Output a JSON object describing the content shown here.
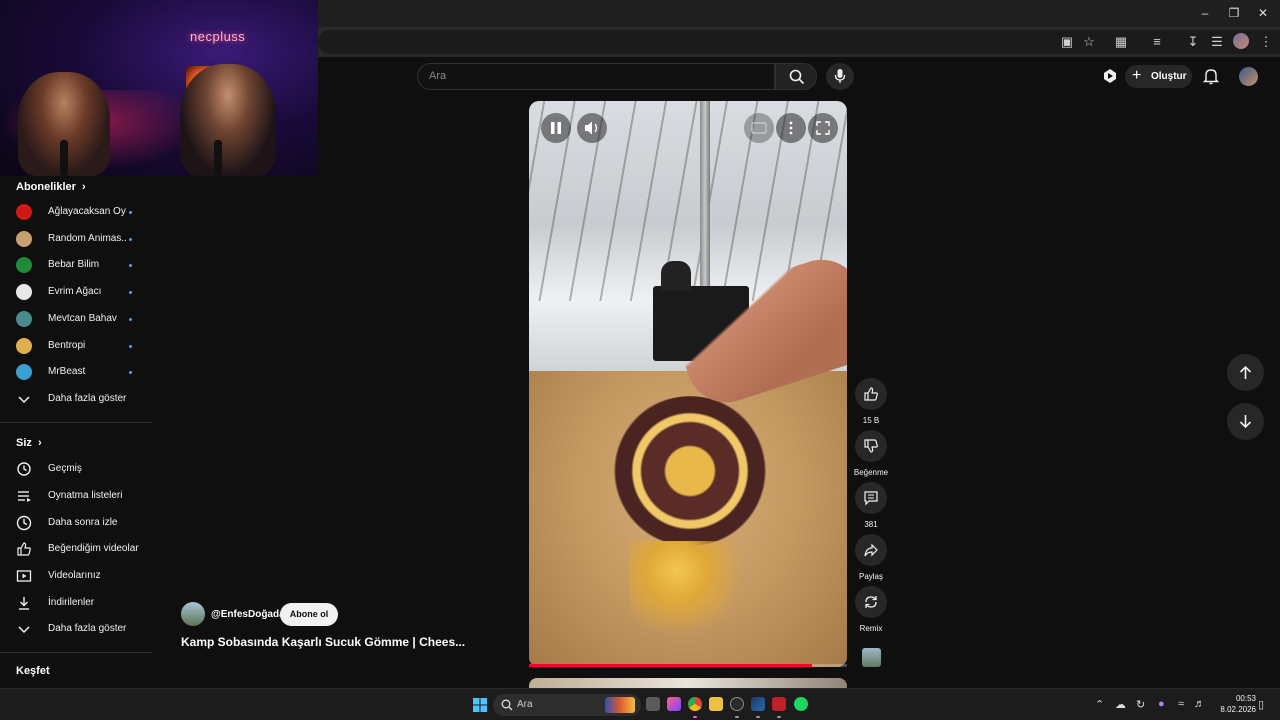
{
  "webcam": {
    "neon_text": "necpluss"
  },
  "search": {
    "placeholder": "Ara"
  },
  "header": {
    "create_label": "Oluştur"
  },
  "sidebar": {
    "subscriptions_title": "Abonelikler",
    "subscriptions": [
      {
        "label": "Ağlayacaksan Oy...",
        "color": "#d01818"
      },
      {
        "label": "Random Animas...",
        "color": "#c8a070"
      },
      {
        "label": "Bebar Bilim",
        "color": "#1e8a3a"
      },
      {
        "label": "Evrim Ağacı",
        "color": "#e8e8e8"
      },
      {
        "label": "Mevtcan Bahav",
        "color": "#4a8a8a"
      },
      {
        "label": "Bentropi",
        "color": "#e0b050"
      },
      {
        "label": "MrBeast",
        "color": "#3aa0d0"
      }
    ],
    "subs_show_more": "Daha fazla göster",
    "you_title": "Siz",
    "you_items": [
      {
        "label": "Geçmiş",
        "icon": "history-icon"
      },
      {
        "label": "Oynatma listeleri",
        "icon": "playlist-icon"
      },
      {
        "label": "Daha sonra izle",
        "icon": "clock-icon"
      },
      {
        "label": "Beğendiğim videolar",
        "icon": "thumb-up-icon"
      },
      {
        "label": "Videolarınız",
        "icon": "video-icon"
      },
      {
        "label": "İndirilenler",
        "icon": "download-icon"
      }
    ],
    "you_show_more": "Daha fazla göster",
    "explore_title": "Keşfet"
  },
  "short": {
    "channel": "@EnfesDoğada",
    "subscribe_label": "Abone ol",
    "title": "Kamp Sobasında Kaşarlı Sucuk Gömme | Chees...",
    "progress": 0.89
  },
  "actions": {
    "likes": "15 B",
    "dislike_label": "Beğenme",
    "comments": "381",
    "share_label": "Paylaş",
    "remix_label": "Remix"
  },
  "taskbar": {
    "search_label": "Ara",
    "time": "00:53",
    "date": "8.02.2026"
  },
  "colors": {
    "accent": "#ff0033",
    "background": "#0f0f0f"
  }
}
